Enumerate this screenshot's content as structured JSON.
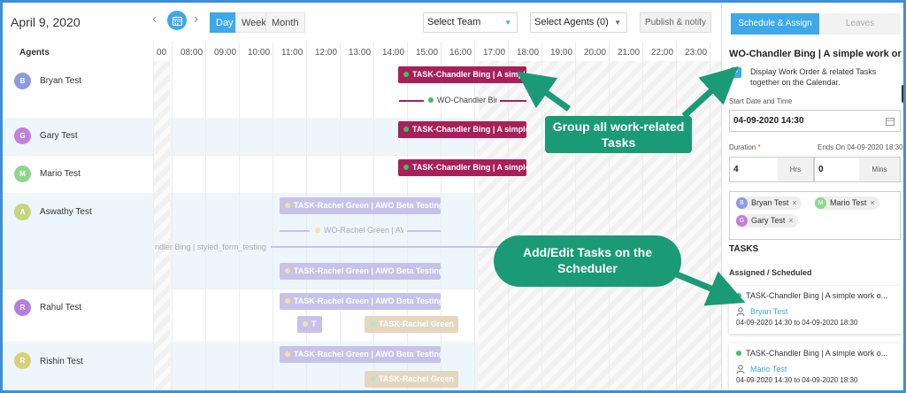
{
  "header": {
    "date": "April 9, 2020",
    "views": [
      "Day",
      "Week",
      "Month"
    ],
    "active_view": "Day",
    "team_select": "Select Team",
    "agents_select": "Select Agents (0)",
    "publish_label": "Publish & notify"
  },
  "grid": {
    "agents_title": "Agents",
    "hours": [
      "00",
      "08:00",
      "09:00",
      "10:00",
      "11:00",
      "12:00",
      "13:00",
      "14:00",
      "15:00",
      "16:00",
      "17:00",
      "18:00",
      "19:00",
      "20:00",
      "21:00",
      "22:00",
      "23:00"
    ],
    "agents": [
      {
        "initial": "B",
        "name": "Bryan Test",
        "color": "#8f9be0"
      },
      {
        "initial": "G",
        "name": "Gary Test",
        "color": "#c27fdd"
      },
      {
        "initial": "M",
        "name": "Mario Test",
        "color": "#8ed68f"
      },
      {
        "initial": "A",
        "name": "Aswathy Test",
        "color": "#c6d67d"
      },
      {
        "initial": "R",
        "name": "Rahul Test",
        "color": "#b57fdf"
      },
      {
        "initial": "R",
        "name": "Rishin Test",
        "color": "#d9cf7a"
      }
    ],
    "bars": {
      "bryan_task": "TASK-Chandler Bing | A simple work order",
      "bryan_wo": "WO-Chandler Bing | A simple work order",
      "gary_task": "TASK-Chandler Bing | A simple work order",
      "mario_task": "TASK-Chandler Bing | A simple work order",
      "aswathy_task": "TASK-Rachel Green | AWO Beta Testing",
      "aswathy_wo": "WO-Rachel Green | AWO Beta Testing",
      "chandler_wo_line": "ndler Bing | styled_form_testing",
      "aswathy_task2": "TASK-Rachel Green | AWO Beta Testing",
      "rahul_task": "TASK-Rachel Green | AWO Beta Testing",
      "rahul_t": "T",
      "rahul_beige": "TASK-Rachel Green",
      "rishin_task": "TASK-Rachel Green | AWO Beta Testing",
      "rishin_beige": "TASK-Rachel Green"
    }
  },
  "panel": {
    "tab_schedule": "Schedule & Assign",
    "tab_leaves": "Leaves",
    "title": "WO-Chandler Bing | A simple work order",
    "display_checkbox_label": "Display Work Order & related Tasks together on the Calendar.",
    "start_label": "Start Date and Time",
    "start_value": "04-09-2020 14:30",
    "duration_label": "Duration",
    "required_mark": "*",
    "ends_on": "Ends On 04-09-2020 18:30",
    "duration_hrs": "4",
    "hrs_label": "Hrs",
    "duration_mins": "0",
    "mins_label": "Mins",
    "assignees": [
      {
        "initial": "B",
        "name": "Bryan Test",
        "color": "#8f9be0"
      },
      {
        "initial": "M",
        "name": "Mario Test",
        "color": "#8ed68f"
      },
      {
        "initial": "G",
        "name": "Gary Test",
        "color": "#c27fdd"
      }
    ],
    "remove_glyph": "×",
    "tasks_heading": "TASKS",
    "assigned_heading": "Assigned / Scheduled",
    "task_cards": [
      {
        "title": "TASK-Chandler Bing | A simple work o...",
        "agent": "Bryan Test",
        "time": "04-09-2020 14:30 to 04-09-2020 18:30"
      },
      {
        "title": "TASK-Chandler Bing | A simple work o...",
        "agent": "Mario Test",
        "time": "04-09-2020 14:30 to 04-09-2020 18:30"
      }
    ]
  },
  "callouts": {
    "group": "Group all work-related Tasks",
    "add_edit": "Add/Edit Tasks on the Scheduler"
  },
  "colors": {
    "accent": "#3da9e8",
    "task_wine": "#a8205a",
    "task_lavender": "#c7c2e9",
    "task_beige": "#e3d7c0",
    "callout_green": "#1a9b76"
  }
}
